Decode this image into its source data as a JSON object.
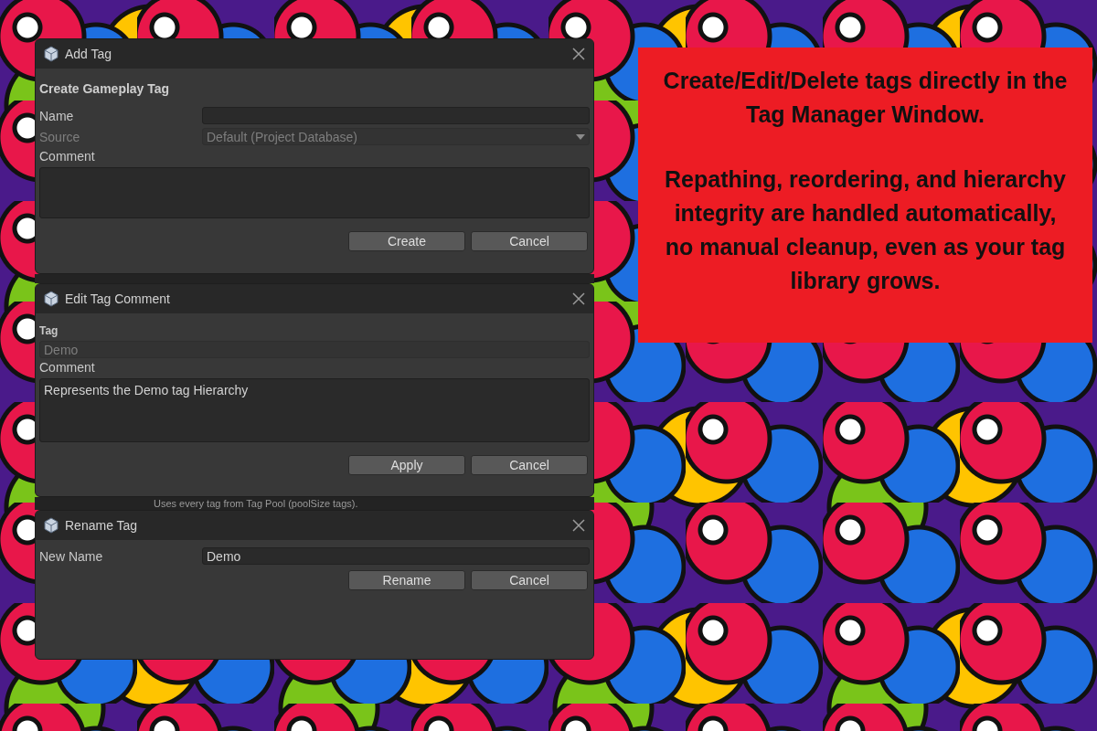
{
  "add_tag": {
    "title": "Add Tag",
    "heading": "Create Gameplay Tag",
    "fields": [
      {
        "kind": "text",
        "label": "Name",
        "disabled": false
      },
      {
        "kind": "dropdown",
        "label": "Source",
        "value": "Default (Project Database)",
        "disabled": true
      },
      {
        "kind": "area",
        "label": "Comment"
      }
    ],
    "buttons": [
      "Create",
      "Cancel"
    ]
  },
  "edit_tag_comment": {
    "title": "Edit Tag Comment",
    "fields": [
      {
        "kind": "stacked",
        "label": "Tag",
        "value": "Demo",
        "disabled": true
      },
      {
        "kind": "area",
        "label": "Comment",
        "value": "Represents the Demo tag Hierarchy"
      }
    ],
    "buttons": [
      "Apply",
      "Cancel"
    ]
  },
  "background_window": {
    "description": "Uses every tag from Tag Pool (poolSize tags)."
  },
  "rename_tag": {
    "title": "Rename Tag",
    "fields": [
      {
        "kind": "text",
        "label": "New Name",
        "value": "Demo",
        "disabled": false
      }
    ],
    "buttons": [
      "Rename",
      "Cancel"
    ]
  },
  "callout": {
    "paragraphs": [
      "Create/Edit/Delete tags directly in the Tag Manager Window.",
      "Repathing, reordering, and hierarchy integrity are handled automatically, no manual cleanup, even as your tag library grows."
    ]
  }
}
